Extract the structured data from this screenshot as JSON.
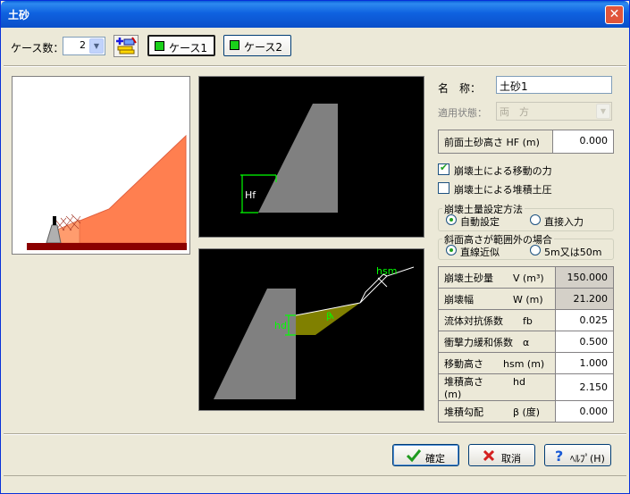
{
  "window": {
    "title": "土砂"
  },
  "toolbar": {
    "case_count_label": "ケース数：",
    "case_count_value": "2",
    "case_tabs": [
      {
        "label": "ケース1",
        "active": true
      },
      {
        "label": "ケース2",
        "active": false
      }
    ]
  },
  "diagram_labels": {
    "hf": "Hf",
    "hsm": "hsm",
    "hd": "hd",
    "beta": "β"
  },
  "form": {
    "name_label": "名　称：",
    "name_value": "土砂1",
    "state_label": "適用状態：",
    "state_value": "両　方",
    "hf_label": "前面土砂高さ HF (m)",
    "hf_value": "0.000",
    "chk_move_label": "崩壊土による移動の力",
    "chk_move_checked": true,
    "chk_deposit_label": "崩壊土による堆積土圧",
    "chk_deposit_checked": false,
    "method_group_title": "崩壊土量設定方法",
    "method_auto": "自動設定",
    "method_direct": "直接入力",
    "slope_group_title": "斜面高さが範囲外の場合",
    "slope_linear": "直線近似",
    "slope_5m50m": "5m又は50m"
  },
  "params": [
    {
      "name": "崩壊土砂量　　V (m³)",
      "value": "150.000",
      "readonly": true
    },
    {
      "name": "崩壊幅　　　　W (m)",
      "value": "21.200",
      "readonly": true
    },
    {
      "name": "流体対抗係数　　fb",
      "value": "0.025",
      "readonly": false
    },
    {
      "name": "衝撃力緩和係数　α",
      "value": "0.500",
      "readonly": false
    },
    {
      "name": "移動高さ　　hsm (m)",
      "value": "1.000",
      "readonly": false
    },
    {
      "name": "堆積高さ　　　hd　(m)",
      "value": "2.150",
      "readonly": false
    },
    {
      "name": "堆積勾配　　　β (度)",
      "value": "0.000",
      "readonly": false
    }
  ],
  "buttons": {
    "ok": "確定",
    "cancel": "取消",
    "help": "ﾍﾙﾌﾟ(H)"
  },
  "colors": {
    "soil": "#ff7f50",
    "base": "#8b0000",
    "wall": "#808080",
    "deposit": "#808000",
    "dim_green": "#00ff00"
  }
}
